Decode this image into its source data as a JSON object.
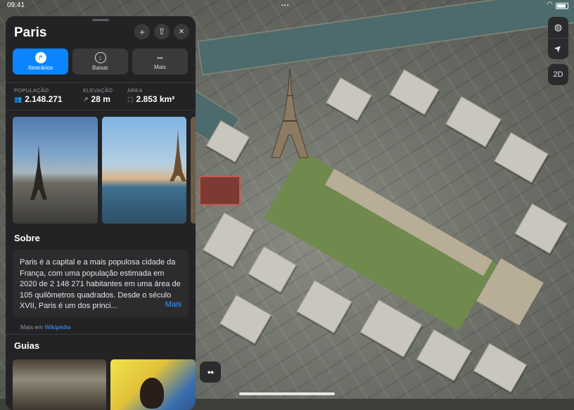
{
  "status_bar": {
    "time": "09:41",
    "dots": "•••"
  },
  "map": {
    "controls": [
      {
        "name": "globe-button",
        "icon": "globe-icon",
        "glyph": "◍"
      },
      {
        "name": "location-button",
        "icon": "location-arrow-icon",
        "glyph": "➤"
      }
    ],
    "view_mode_label": "2D",
    "binoculars_glyph": "●●"
  },
  "panel": {
    "title": "Paris",
    "header_buttons": [
      {
        "name": "add-button",
        "icon": "plus-icon",
        "glyph": "+"
      },
      {
        "name": "share-button",
        "icon": "share-icon",
        "glyph": "⇧"
      },
      {
        "name": "close-button",
        "icon": "close-icon",
        "glyph": "✕"
      }
    ],
    "actions": [
      {
        "label": "Itinerários",
        "icon": "directions-icon",
        "glyph": "↱",
        "primary": true
      },
      {
        "label": "Baixar",
        "icon": "download-icon",
        "glyph": "↓",
        "primary": false
      },
      {
        "label": "Mais",
        "icon": "more-icon",
        "glyph": "•••",
        "primary": false
      }
    ],
    "stats": [
      {
        "label": "POPULAÇÃO",
        "value": "2.148.271",
        "icon": "people-icon",
        "glyph": "👥"
      },
      {
        "label": "ELEVAÇÃO",
        "value": "28 m",
        "icon": "elevation-arrow-icon",
        "glyph": "↗"
      },
      {
        "label": "ÁREA",
        "value": "2.853 km²",
        "icon": "area-icon",
        "glyph": "⬚"
      }
    ],
    "about": {
      "heading": "Sobre",
      "text": "Paris é a capital e a mais populosa cidade da França, com uma população estimada em 2020 de 2 148 271 habitantes em uma área de 105 quilômetros quadrados. Desde o século XVII, Paris é um dos princi...",
      "more_label": "Mais",
      "source_prefix": "Mais em",
      "source_link": "Wikipédia"
    },
    "guides_heading": "Guias"
  },
  "colors": {
    "accent": "#0a84ff",
    "panel_bg": "#232325",
    "button_bg": "#3a3a3c"
  }
}
